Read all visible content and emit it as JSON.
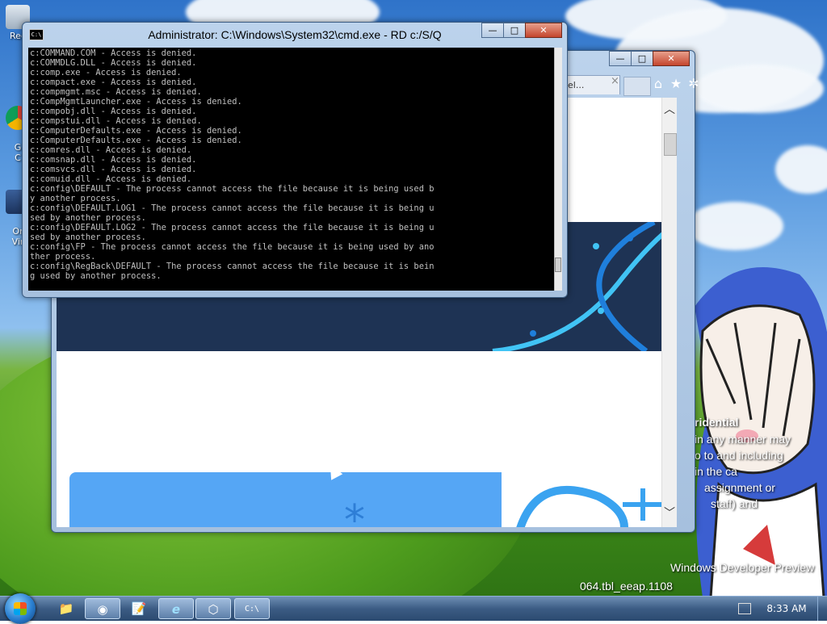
{
  "desktop": {
    "icons": [
      {
        "label": "Rec",
        "name": "recycle-bin"
      },
      {
        "label": "G\nC",
        "name": "chrome-shortcut"
      },
      {
        "label": "Or\nVir",
        "name": "virtualbox-shortcut"
      }
    ],
    "watermark": {
      "title": "ridential",
      "lines": [
        "in any manner may",
        "o to and including",
        "in the ca",
        "assignment or",
        "staff) and"
      ],
      "build_title": "Windows Developer Preview",
      "build_id": "064.tbl_eeap.1108"
    }
  },
  "browser": {
    "tab_label": "el...",
    "tab_close": "×",
    "icons": [
      "home-icon",
      "star-icon",
      "gear-icon"
    ],
    "title_buttons": {
      "minimize": "—",
      "maximize": "□",
      "close": "✕"
    }
  },
  "cmd": {
    "title": "Administrator: C:\\Windows\\System32\\cmd.exe - RD  c:/S/Q",
    "icon_label": "C:\\",
    "title_buttons": {
      "minimize": "—",
      "maximize": "□",
      "close": "✕"
    },
    "lines": [
      "c:COMMAND.COM - Access is denied.",
      "c:COMMDLG.DLL - Access is denied.",
      "c:comp.exe - Access is denied.",
      "c:compact.exe - Access is denied.",
      "c:compmgmt.msc - Access is denied.",
      "c:CompMgmtLauncher.exe - Access is denied.",
      "c:compobj.dll - Access is denied.",
      "c:compstui.dll - Access is denied.",
      "c:ComputerDefaults.exe - Access is denied.",
      "c:ComputerDefaults.exe - Access is denied.",
      "c:comres.dll - Access is denied.",
      "c:comsnap.dll - Access is denied.",
      "c:comsvcs.dll - Access is denied.",
      "c:comuid.dll - Access is denied.",
      "c:config\\DEFAULT - The process cannot access the file because it is being used b",
      "y another process.",
      "c:config\\DEFAULT.LOG1 - The process cannot access the file because it is being u",
      "sed by another process.",
      "c:config\\DEFAULT.LOG2 - The process cannot access the file because it is being u",
      "sed by another process.",
      "c:config\\FP - The process cannot access the file because it is being used by ano",
      "ther process.",
      "c:config\\RegBack\\DEFAULT - The process cannot access the file because it is bein",
      "g used by another process."
    ]
  },
  "taskbar": {
    "items": [
      {
        "name": "explorer-taskbar-button",
        "icon": "📁"
      },
      {
        "name": "chrome-taskbar-button",
        "icon": "◉"
      },
      {
        "name": "notepad-taskbar-button",
        "icon": "📝"
      },
      {
        "name": "ie-taskbar-button",
        "icon": "e"
      },
      {
        "name": "virtualbox-taskbar-button",
        "icon": "⬡"
      },
      {
        "name": "cmd-taskbar-button",
        "icon": "C:\\"
      }
    ],
    "clock": "8:33 AM"
  }
}
